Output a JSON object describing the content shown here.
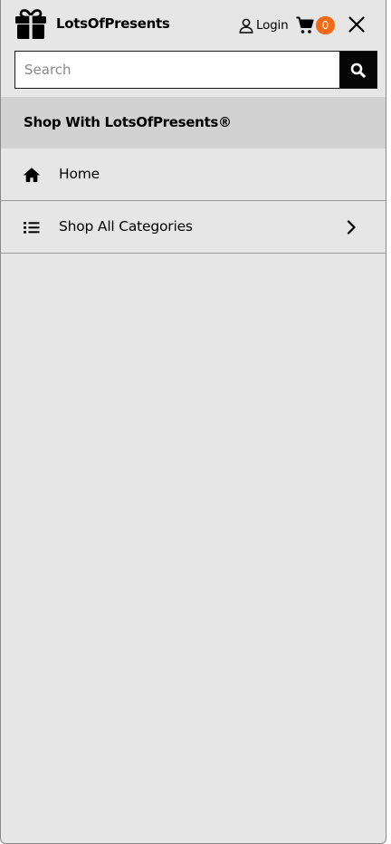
{
  "header": {
    "brand": "LotsOfPresents",
    "login_label": "Login",
    "cart_count": "0",
    "logo_icon": "gift-icon",
    "user_icon": "user-icon",
    "cart_icon": "cart-icon",
    "close_icon": "close-icon",
    "accent_color": "#f26a16"
  },
  "search": {
    "placeholder": "Search",
    "value": "",
    "icon": "search-icon"
  },
  "menu": {
    "section_title": "Shop With LotsOfPresents®",
    "items": [
      {
        "label": "Home",
        "icon": "home-icon"
      },
      {
        "label": "Shop All Categories",
        "icon": "list-icon",
        "chevron": "chevron-right-icon"
      }
    ]
  }
}
